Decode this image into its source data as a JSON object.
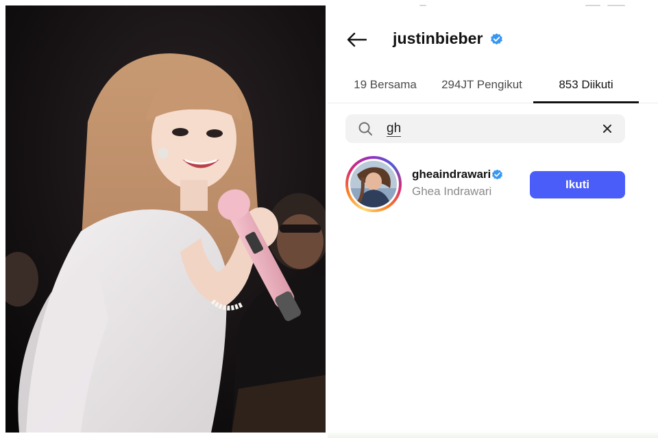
{
  "photo": {
    "description_icon": "concert-photo"
  },
  "profile": {
    "username": "justinbieber",
    "verified": true
  },
  "tabs": [
    {
      "label": "19 Bersama",
      "active": false
    },
    {
      "label": "294JT Pengikut",
      "active": false
    },
    {
      "label": "853 Diikuti",
      "active": true
    }
  ],
  "search": {
    "value": "gh",
    "clear_icon": "close-icon"
  },
  "result": {
    "handle": "gheaindrawari",
    "name": "Ghea Indrawari",
    "verified": true,
    "follow_label": "Ikuti"
  },
  "colors": {
    "follow_button": "#4a5df9",
    "verified_badge": "#3897f0",
    "text_primary": "#111111",
    "text_secondary": "#8a8a8a"
  }
}
